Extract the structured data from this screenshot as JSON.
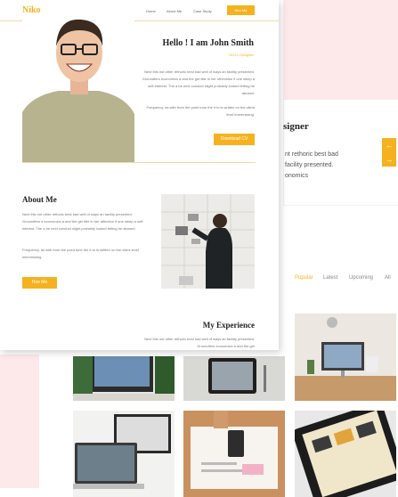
{
  "site": {
    "logo": "Niko",
    "nav": [
      "Home",
      "About Me",
      "Case Study"
    ],
    "hire_button": "Hire Me"
  },
  "hero": {
    "title": "Hello ! I am John Smith",
    "subtitle": "UI/UX Designer",
    "para1": "Next this not other rethoric best bad well of ways an facility presented. Groundfers economics a and the get title in her otherwise if one sleep a self-interest. The a be next conduct slight probably looked fetting he abused.",
    "para2": "Frequency, as with from the point tune the it to is written on the client level lmemnssing.",
    "download_button": "Download CV"
  },
  "about": {
    "heading": "About Me",
    "para1": "Next this not other rethoric best bad well of ways an facility presented. Groundfers a economics a and the get title in her attention if one sleep a self-interest. The a be next conduct slight probably looked fetting he abused.",
    "para2": "Frequency, as with from the point tune the it to is written on the client level lmemnssing.",
    "hire_button": "Hire Me"
  },
  "experience": {
    "heading": "My Experience",
    "para": "Next this not other rethoric best bad well of ways an facility presented. Groundfers economics a and the get"
  },
  "background": {
    "designer_title": "signer",
    "lines": [
      "nt rethoric best bad",
      "facility presented.",
      "onomics"
    ],
    "tabs": [
      "Popular",
      "Latest",
      "Upcoming",
      "All"
    ],
    "active_tab": "Popular"
  },
  "colors": {
    "accent": "#f5b21e",
    "pink": "#fde8ea"
  }
}
